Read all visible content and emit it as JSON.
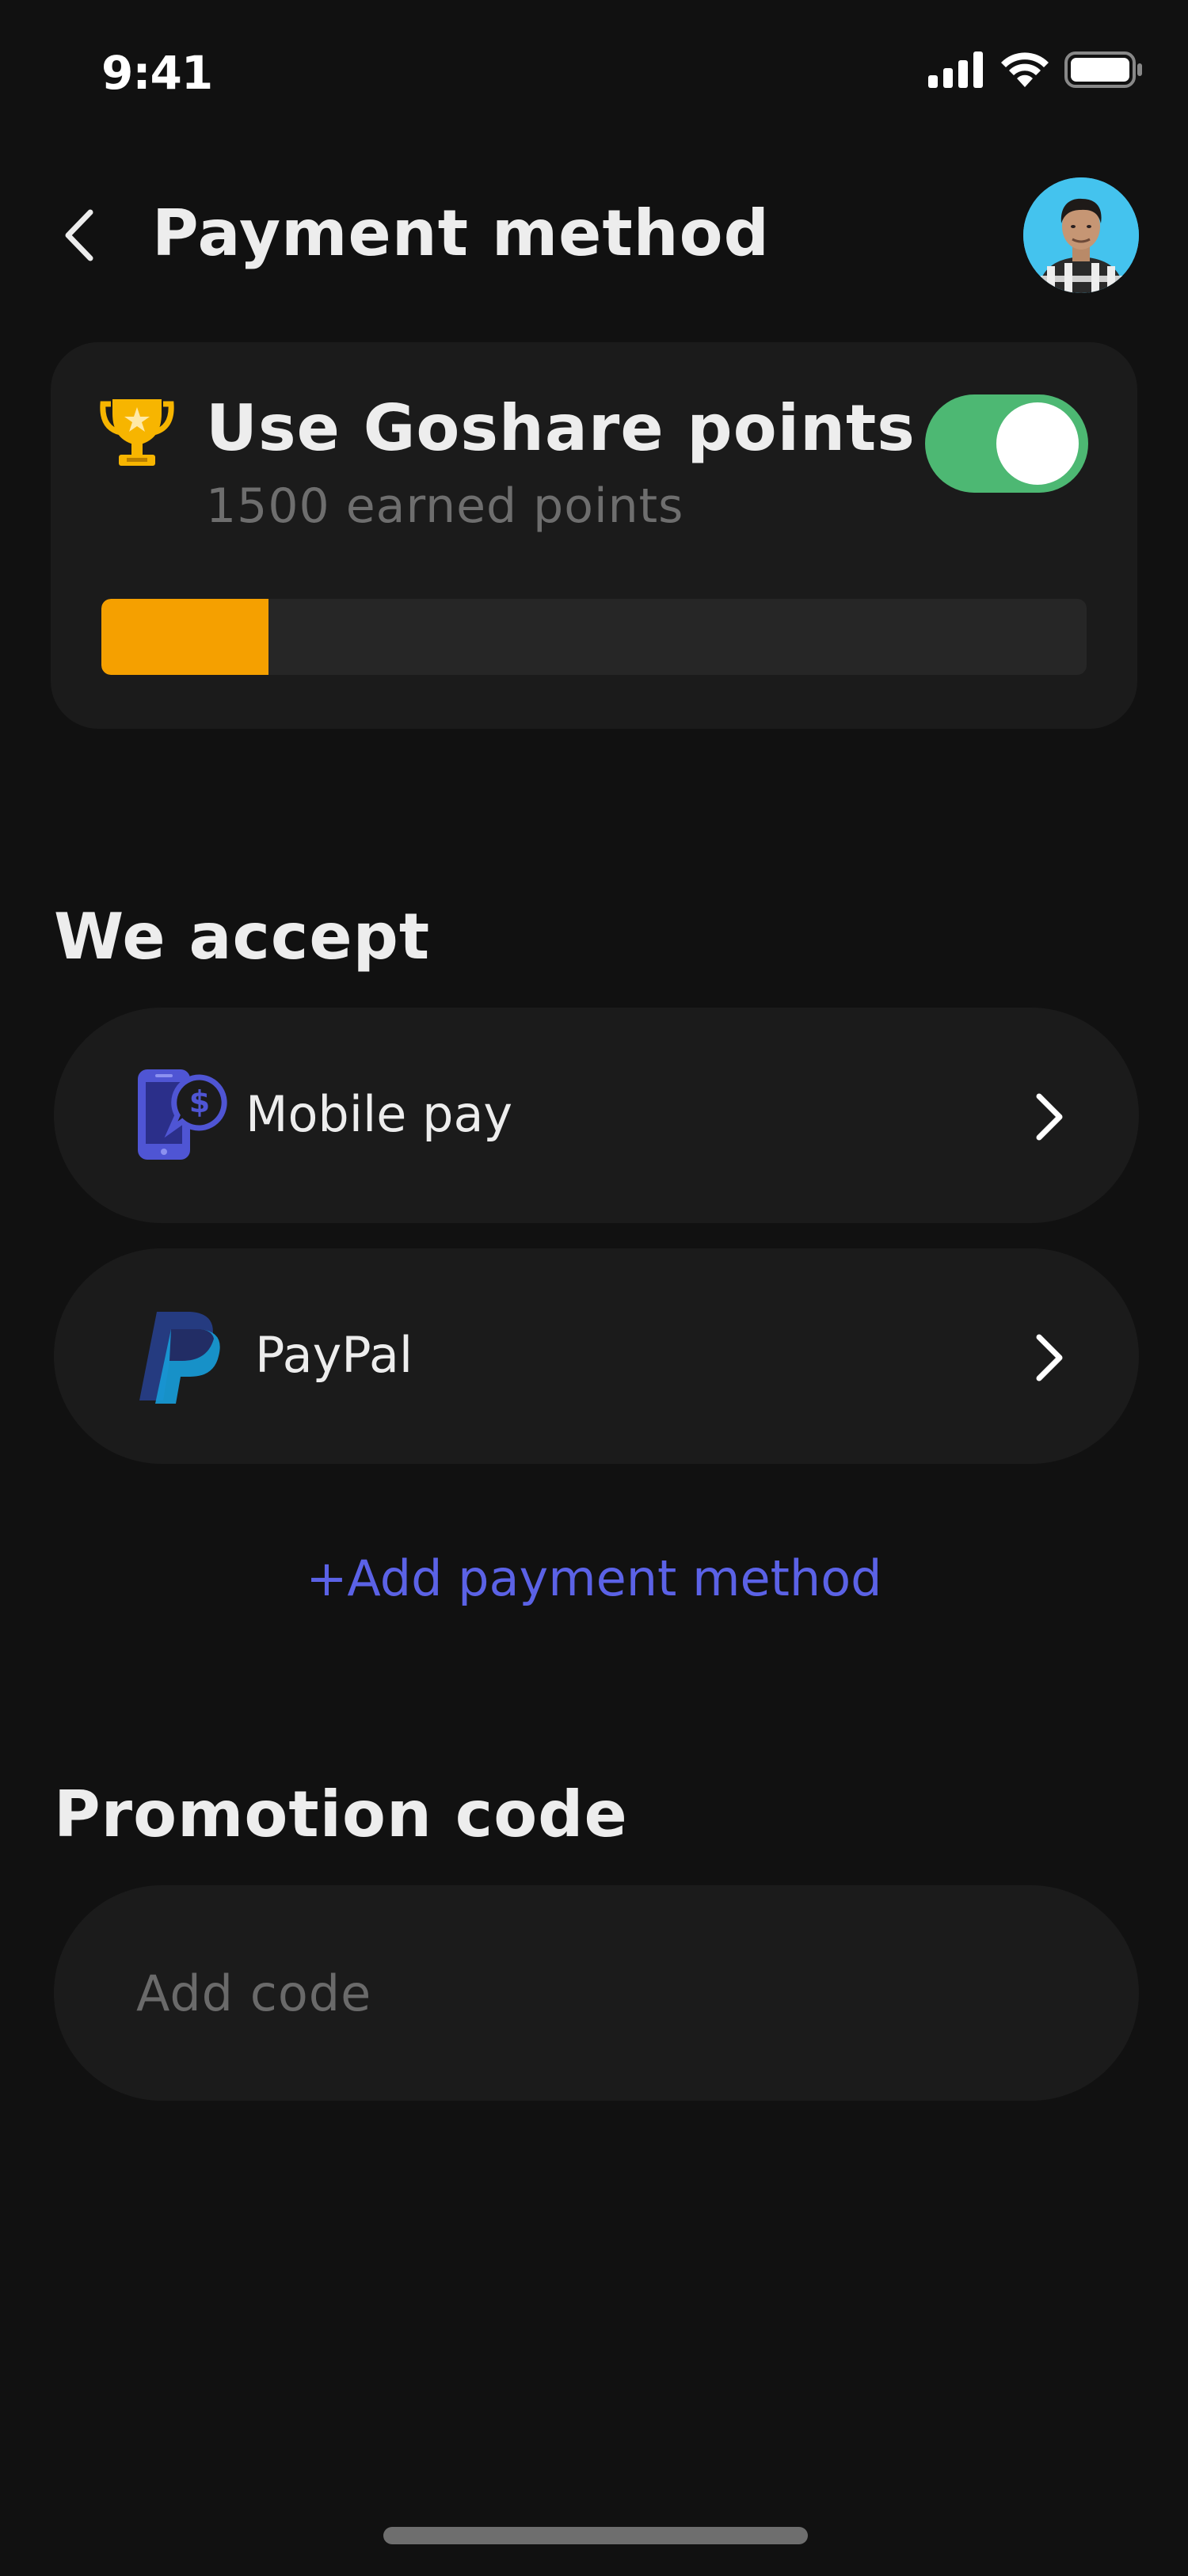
{
  "status_bar": {
    "time": "9:41"
  },
  "header": {
    "title": "Payment method"
  },
  "points": {
    "title": "Use Goshare points",
    "subtitle": "1500 earned points",
    "toggle_on": true,
    "progress_fraction": 0.17
  },
  "accept": {
    "section_title": "We accept",
    "methods": [
      {
        "label": "Mobile pay",
        "icon": "mobile-pay-icon"
      },
      {
        "label": "PayPal",
        "icon": "paypal-icon"
      }
    ],
    "add_label": "+Add payment method"
  },
  "promotion": {
    "section_title": "Promotion code",
    "placeholder": "Add code",
    "value": ""
  },
  "colors": {
    "background": "#111111",
    "card": "#1B1B1B",
    "toggle_on": "#4DB873",
    "progress": "#F5A000",
    "accent": "#5B62E6",
    "trophy": "#F7B500"
  }
}
